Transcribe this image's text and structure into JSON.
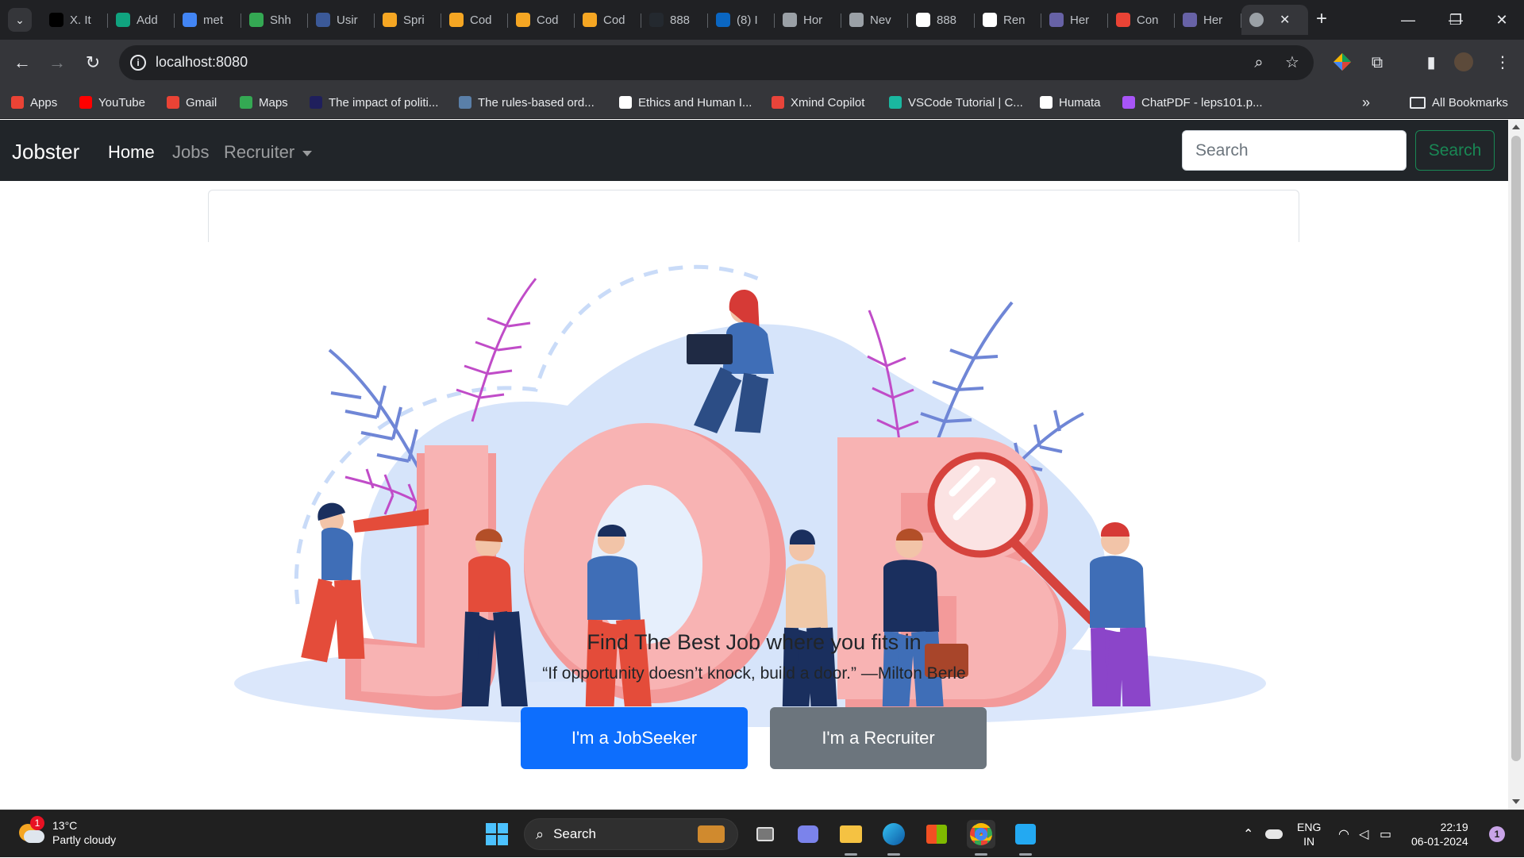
{
  "browser": {
    "tabs": [
      {
        "label": "X. It",
        "icon": "x-icon",
        "color": "#000000"
      },
      {
        "label": "Add",
        "icon": "chatgpt-icon",
        "color": "#10a37f"
      },
      {
        "label": "met",
        "icon": "google-icon",
        "color": "#4285f4"
      },
      {
        "label": "Shh",
        "icon": "leaf-icon",
        "color": "#34a853"
      },
      {
        "label": "Usir",
        "icon": "app-icon",
        "color": "#3b5998"
      },
      {
        "label": "Spri",
        "icon": "codecademy-icon",
        "color": "#f5a623"
      },
      {
        "label": "Cod",
        "icon": "codecademy-icon",
        "color": "#f5a623"
      },
      {
        "label": "Cod",
        "icon": "codecademy-icon",
        "color": "#f5a623"
      },
      {
        "label": "Cod",
        "icon": "codecademy-icon",
        "color": "#f5a623"
      },
      {
        "label": "888",
        "icon": "github-icon",
        "color": "#24292f"
      },
      {
        "label": "(8) I",
        "icon": "linkedin-icon",
        "color": "#0a66c2"
      },
      {
        "label": "Hor",
        "icon": "globe-icon",
        "color": "#9aa0a6"
      },
      {
        "label": "Nev",
        "icon": "globe-icon",
        "color": "#9aa0a6"
      },
      {
        "label": "888",
        "icon": "github-icon",
        "color": "#ffffff"
      },
      {
        "label": "Ren",
        "icon": "render-icon",
        "color": "#ffffff"
      },
      {
        "label": "Her",
        "icon": "heroku-icon",
        "color": "#6762a6"
      },
      {
        "label": "Con",
        "icon": "gmail-icon",
        "color": "#ea4335"
      },
      {
        "label": "Her",
        "icon": "heroku-icon",
        "color": "#6762a6"
      }
    ],
    "active_tab_close": "✕",
    "url": "localhost:8080",
    "bookmarks": [
      {
        "label": "Apps",
        "icon": "apps-grid-icon",
        "color": "#ea4335"
      },
      {
        "label": "YouTube",
        "icon": "youtube-icon",
        "color": "#ff0000"
      },
      {
        "label": "Gmail",
        "icon": "gmail-icon",
        "color": "#ea4335"
      },
      {
        "label": "Maps",
        "icon": "maps-icon",
        "color": "#34a853"
      },
      {
        "label": "The impact of politi...",
        "icon": "doc-icon",
        "color": "#1f1f5c"
      },
      {
        "label": "The rules-based ord...",
        "icon": "site-icon",
        "color": "#5a7fa8"
      },
      {
        "label": "Ethics and Human I...",
        "icon": "book-icon",
        "color": "#ffffff"
      },
      {
        "label": "Xmind Copilot",
        "icon": "xmind-icon",
        "color": "#e8443a"
      },
      {
        "label": "VSCode Tutorial | C...",
        "icon": "vscode-tutorial-icon",
        "color": "#1ab7a0"
      },
      {
        "label": "Humata",
        "icon": "humata-icon",
        "color": "#ffffff"
      },
      {
        "label": "ChatPDF - leps101.p...",
        "icon": "chatpdf-icon",
        "color": "#a855f7"
      }
    ],
    "all_bookmarks": "All Bookmarks"
  },
  "navbar": {
    "brand": "Jobster",
    "links": [
      "Home",
      "Jobs",
      "Recruiter"
    ],
    "search_placeholder": "Search",
    "search_button": "Search"
  },
  "hero": {
    "headline": "Find The Best Job where you fits in",
    "quote": "“If opportunity doesn’t knock, build a door.” —Milton Berle",
    "seeker_button": "I'm a JobSeeker",
    "recruiter_button": "I'm a Recruiter",
    "art_word": "JOB"
  },
  "colors": {
    "navbar_bg": "#212529",
    "primary": "#0d6efd",
    "secondary": "#6c757d",
    "success": "#198754",
    "letters": "#f8b3b3"
  },
  "taskbar": {
    "weather_temp": "13°C",
    "weather_desc": "Partly cloudy",
    "weather_badge": "1",
    "search_label": "Search",
    "lang_top": "ENG",
    "lang_bottom": "IN",
    "time": "22:19",
    "date": "06-01-2024",
    "notification_count": "1"
  }
}
